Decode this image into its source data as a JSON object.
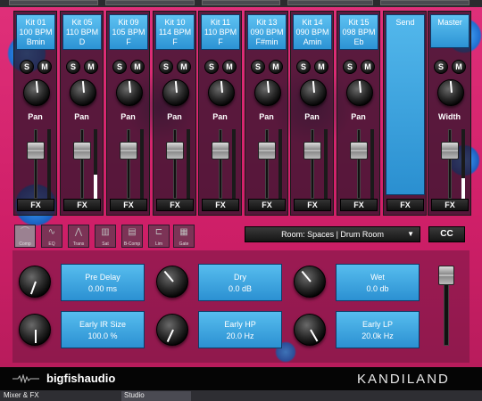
{
  "channels": [
    {
      "kit": "Kit 01",
      "bpm": "100 BPM",
      "key": "Bmin"
    },
    {
      "kit": "Kit 05",
      "bpm": "110 BPM",
      "key": "D"
    },
    {
      "kit": "Kit 09",
      "bpm": "105 BPM",
      "key": "F"
    },
    {
      "kit": "Kit 10",
      "bpm": "114 BPM",
      "key": "F"
    },
    {
      "kit": "Kit 11",
      "bpm": "110 BPM",
      "key": "F"
    },
    {
      "kit": "Kit 13",
      "bpm": "090 BPM",
      "key": "F#min"
    },
    {
      "kit": "Kit 14",
      "bpm": "090 BPM",
      "key": "Amin"
    },
    {
      "kit": "Kit 15",
      "bpm": "098 BPM",
      "key": "Eb"
    }
  ],
  "solo_label": "S",
  "mute_label": "M",
  "pan_label": "Pan",
  "fx_label": "FX",
  "send": {
    "label": "Send",
    "fx_label": "FX"
  },
  "master": {
    "label": "Master",
    "width_label": "Width",
    "fx_label": "FX"
  },
  "effects": [
    "Comp",
    "EQ",
    "Trans",
    "Sat",
    "B-Comp",
    "Lim",
    "Gate"
  ],
  "room_select": {
    "value": "Room: Spaces | Drum Room",
    "arrow": "▼"
  },
  "cc_label": "CC",
  "params": [
    {
      "name": "Pre Delay",
      "value": "0.00 ms"
    },
    {
      "name": "Dry",
      "value": "0.0 dB"
    },
    {
      "name": "Wet",
      "value": "0.0 db"
    },
    {
      "name": "Early IR Size",
      "value": "100.0 %"
    },
    {
      "name": "Early HP",
      "value": "20.0 Hz"
    },
    {
      "name": "Early LP",
      "value": "20.0k Hz"
    }
  ],
  "footer": {
    "brand": "bigfishaudio",
    "product": "KANDILAND"
  },
  "tabs": [
    "Mixer & FX",
    "Studio"
  ],
  "colors": {
    "accent": "#3aa3e0",
    "background": "#d8246e",
    "footer": "#050505"
  }
}
